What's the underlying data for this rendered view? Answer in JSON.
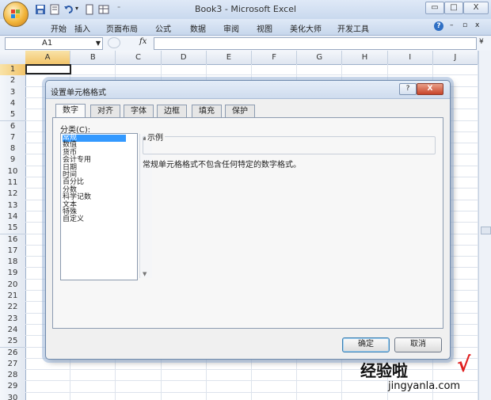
{
  "window": {
    "title": "Book3 - Microsoft Excel",
    "controls": {
      "minimize": "▭",
      "restore": "□",
      "close": "X"
    }
  },
  "ribbon": {
    "tabs": [
      "开始",
      "插入",
      "页面布局",
      "公式",
      "数据",
      "审阅",
      "视图",
      "美化大师",
      "开发工具"
    ],
    "help": "?"
  },
  "formula_bar": {
    "name_box": "A1",
    "fx": "fx",
    "formula": ""
  },
  "sheet": {
    "columns": [
      "A",
      "B",
      "C",
      "D",
      "E",
      "F",
      "G",
      "H",
      "I",
      "J"
    ],
    "rows": [
      "1",
      "2",
      "3",
      "4",
      "5",
      "6",
      "7",
      "8",
      "9",
      "10",
      "11",
      "12",
      "13",
      "14",
      "15",
      "16",
      "17",
      "18",
      "19",
      "20",
      "21",
      "22",
      "23",
      "24",
      "25",
      "26",
      "27",
      "28",
      "29",
      "30"
    ],
    "active_cell": "A1"
  },
  "dialog": {
    "title": "设置单元格格式",
    "help": "?",
    "close": "X",
    "tabs": [
      "数字",
      "对齐",
      "字体",
      "边框",
      "填充",
      "保护"
    ],
    "active_tab": "数字",
    "category_label": "分类(C):",
    "categories": [
      "常规",
      "数值",
      "货币",
      "会计专用",
      "日期",
      "时间",
      "百分比",
      "分数",
      "科学记数",
      "文本",
      "特殊",
      "自定义"
    ],
    "selected_category": "常规",
    "sample_label": "示例",
    "description": "常规单元格格式不包含任何特定的数字格式。",
    "ok_label": "确定",
    "cancel_label": "取消"
  },
  "watermark": {
    "text": "经验啦",
    "check": "√",
    "url": "jingyanla.com"
  },
  "colors": {
    "selection": "#3399ff",
    "accent_red": "#e02020"
  }
}
